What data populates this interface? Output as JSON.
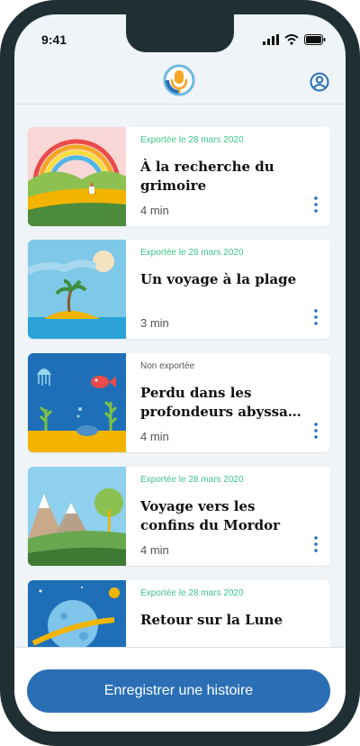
{
  "status_bar": {
    "time": "9:41"
  },
  "colors": {
    "accent": "#2a6fb6",
    "exported": "#3fc58a",
    "logo": "#f5a623"
  },
  "header": {
    "logo_icon": "microphone-logo-icon",
    "profile_icon": "user-circle-icon"
  },
  "stories": [
    {
      "status": "Exportée le 28 mars 2020",
      "exported": true,
      "title": "À la recherche du grimoire",
      "duration": "4 min",
      "thumbnail": "rainbow-landscape"
    },
    {
      "status": "Exportée le 28 mars 2020",
      "exported": true,
      "title": "Un voyage à la plage",
      "duration": "3 min",
      "thumbnail": "beach-island"
    },
    {
      "status": "Non exportée",
      "exported": false,
      "title": "Perdu dans les profondeurs abyssa…",
      "duration": "4 min",
      "thumbnail": "underwater"
    },
    {
      "status": "Exportée le 28 mars 2020",
      "exported": true,
      "title": "Voyage vers les confins du Mordor",
      "duration": "4 min",
      "thumbnail": "mountains"
    },
    {
      "status": "Exportée le 28 mars 2020",
      "exported": true,
      "title": "Retour sur la Lune",
      "duration": "",
      "thumbnail": "space-planet"
    }
  ],
  "footer": {
    "record_button_label": "Enregistrer une histoire"
  }
}
